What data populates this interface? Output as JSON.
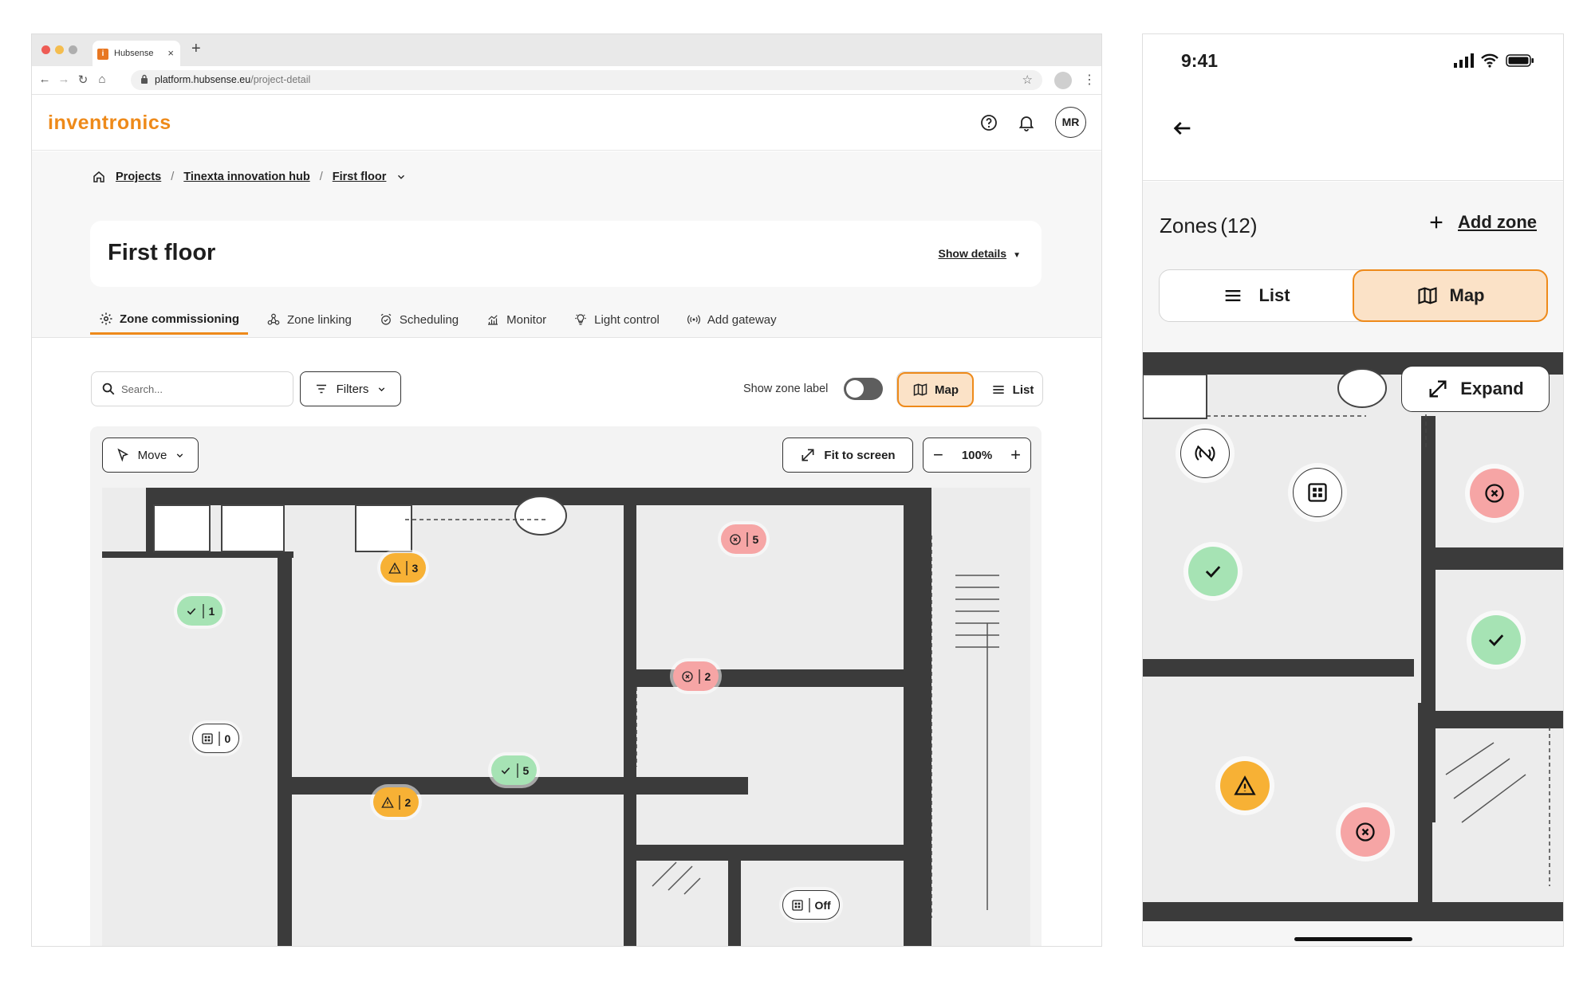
{
  "browser": {
    "tab_title": "Hubsense",
    "tab_favicon_letter": "i",
    "url_host": "platform.hubsense.eu",
    "url_path": "/project-detail"
  },
  "app": {
    "logo": "inventronics",
    "avatar_initials": "MR",
    "accent_color": "#ee8a1a"
  },
  "breadcrumb": {
    "items": [
      "Projects",
      "Tinexta innovation hub",
      "First floor"
    ]
  },
  "floor": {
    "title": "First floor",
    "show_details": "Show details"
  },
  "tabs": [
    {
      "label": "Zone commissioning",
      "icon": "gear-icon",
      "active": true
    },
    {
      "label": "Zone linking",
      "icon": "link-nodes-icon",
      "active": false
    },
    {
      "label": "Scheduling",
      "icon": "alarm-clock-icon",
      "active": false
    },
    {
      "label": "Monitor",
      "icon": "chart-icon",
      "active": false
    },
    {
      "label": "Light control",
      "icon": "bulb-icon",
      "active": false
    },
    {
      "label": "Add gateway",
      "icon": "broadcast-icon",
      "active": false
    }
  ],
  "toolbar": {
    "search_placeholder": "Search...",
    "filters_label": "Filters",
    "show_zone_label": "Show zone label",
    "show_zone_label_on": false,
    "map_label": "Map",
    "list_label": "List"
  },
  "map_tools": {
    "move_label": "Move",
    "fit_label": "Fit to screen",
    "zoom_level": "100%"
  },
  "zones": [
    {
      "status": "error",
      "count": "5"
    },
    {
      "status": "warning",
      "count": "3"
    },
    {
      "status": "ok",
      "count": "1"
    },
    {
      "status": "error",
      "count": "2"
    },
    {
      "status": "gateway",
      "count": "0"
    },
    {
      "status": "ok",
      "count": "5"
    },
    {
      "status": "warning",
      "count": "2"
    },
    {
      "status": "gateway",
      "count": "Off"
    }
  ],
  "status_colors": {
    "ok": "#a6e3b4",
    "warning": "#f7b135",
    "error": "#f6a5a5"
  },
  "mobile": {
    "time": "9:41",
    "zones_label": "Zones",
    "zones_count": "(12)",
    "add_zone": "Add zone",
    "list_label": "List",
    "map_label": "Map",
    "expand_label": "Expand",
    "markers": [
      "no-signal",
      "gateway",
      "ok",
      "error",
      "ok",
      "warning",
      "error"
    ]
  }
}
